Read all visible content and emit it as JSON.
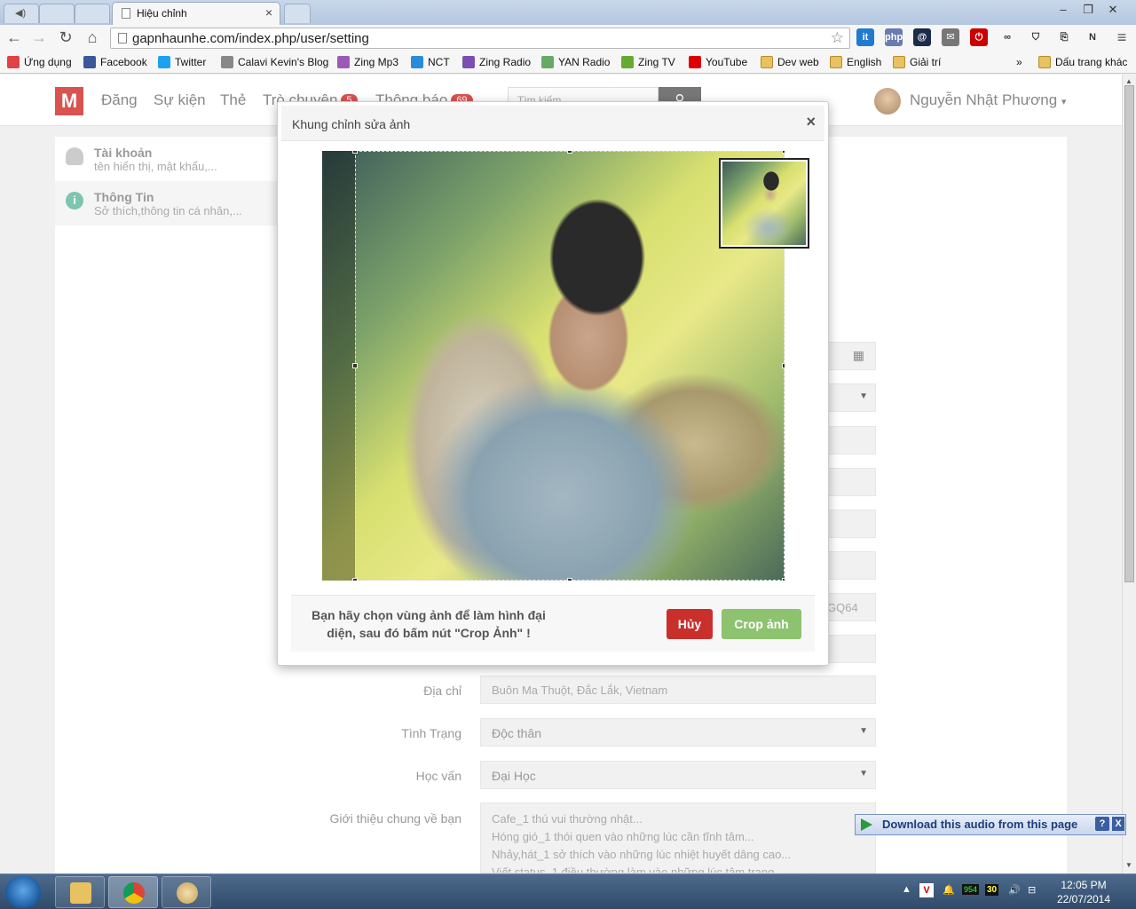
{
  "browser": {
    "tab_title": "Hiệu chỉnh",
    "tab_close": "×",
    "url": "gapnhaunhe.com/index.php/user/setting",
    "extensions": [
      "it",
      "php",
      "@",
      "✉",
      "⏻",
      "∞",
      "⛉",
      "⎘",
      "N"
    ],
    "bookmarks": [
      {
        "label": "Ứng dụng",
        "icon": "apps-grid-icon"
      },
      {
        "label": "Facebook",
        "icon": "facebook-icon"
      },
      {
        "label": "Twitter",
        "icon": "twitter-icon"
      },
      {
        "label": "Calavi Kevin's Blog",
        "icon": "blog-icon"
      },
      {
        "label": "Zing Mp3",
        "icon": "zing-mp3-icon"
      },
      {
        "label": "NCT",
        "icon": "nct-icon"
      },
      {
        "label": "Zing Radio",
        "icon": "zing-radio-icon"
      },
      {
        "label": "YAN Radio",
        "icon": "yan-radio-icon"
      },
      {
        "label": "Zing TV",
        "icon": "zing-tv-icon"
      },
      {
        "label": "YouTube",
        "icon": "youtube-icon"
      },
      {
        "label": "Dev web",
        "icon": "folder-icon"
      },
      {
        "label": "English",
        "icon": "folder-icon"
      },
      {
        "label": "Giải trí",
        "icon": "folder-icon"
      }
    ],
    "bookmarks_overflow": "»",
    "other_bookmarks": "Dấu trang khác"
  },
  "site": {
    "logo": "M",
    "nav": [
      {
        "label": "Đăng"
      },
      {
        "label": "Sự kiện"
      },
      {
        "label": "Thẻ"
      },
      {
        "label": "Trò chuyện",
        "badge": "5"
      },
      {
        "label": "Thông báo",
        "badge": "69"
      }
    ],
    "search_placeholder": "Tìm kiếm",
    "user_name": "Nguyễn Nhật Phương"
  },
  "sidebar": [
    {
      "title": "Tài khoản",
      "subtitle": "tên hiển thị, mật khẩu,...",
      "icon": "user-icon"
    },
    {
      "title": "Thông Tin",
      "subtitle": "Sở thích,thông tin cá nhân,...",
      "icon": "info-icon"
    }
  ],
  "form": {
    "partial_value": "GQ64",
    "address": {
      "label": "Địa chỉ",
      "value": "Buôn Ma Thuột, Đắc Lắk, Vietnam"
    },
    "status": {
      "label": "Tình Trạng",
      "value": "Độc thân"
    },
    "education": {
      "label": "Học vấn",
      "value": "Đại Học"
    },
    "intro": {
      "label": "Giới thiệu chung về bạn",
      "lines": [
        "Cafe_1 thú vui thường nhật...",
        "Hóng gió_1 thói quen vào những lúc cần tĩnh tâm...",
        "Nhảy,hát_1 sở thích vào những lúc nhiệt huyết dâng cao...",
        "Viết status_1 điều thường làm vào những lúc tâm trạng..."
      ]
    }
  },
  "modal": {
    "title": "Khung chỉnh sửa ảnh",
    "close": "×",
    "hint": "Bạn hãy chọn vùng ảnh để làm hình đại diện, sau đó bấm nút \"Crop Ảnh\" !",
    "cancel_label": "Hủy",
    "crop_label": "Crop ảnh"
  },
  "download_bar": {
    "label": "Download this audio from this page",
    "help": "?",
    "close": "X"
  },
  "taskbar": {
    "time": "12:05 PM",
    "date": "22/07/2014",
    "tray_badge_1": "954",
    "tray_badge_2": "30"
  },
  "colors": {
    "brand_red": "#d9534f",
    "cancel": "#c9302c",
    "crop": "#8dc26f"
  }
}
